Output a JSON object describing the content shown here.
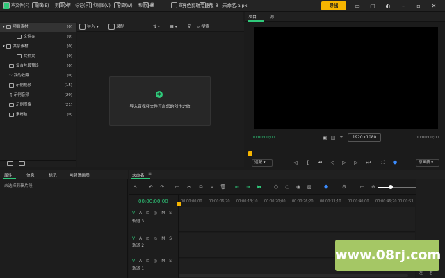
{
  "menu": [
    "文件(F)",
    "编辑(E)",
    "剪辑(X)",
    "标记(M)",
    "视图(V)",
    "窗口(W)",
    "帮助(H)"
  ],
  "title": "亮色剪辑专业版 8 - 未命名.alpx",
  "export_label": "导出",
  "toolbar": {
    "items": [
      "素",
      "文",
      "转",
      "行",
      "滤",
      "叠",
      "音",
      "贴"
    ]
  },
  "tree": {
    "items": [
      {
        "label": "项目素材",
        "count": "(0)"
      },
      {
        "label": "文件夹",
        "count": "(0)"
      },
      {
        "label": "共享素材",
        "count": "(0)"
      },
      {
        "label": "文件夹",
        "count": "(0)"
      },
      {
        "label": "复合片段预设",
        "count": "(0)"
      },
      {
        "label": "我的收藏",
        "count": "(0)"
      },
      {
        "label": "示例视频",
        "count": "(15)"
      },
      {
        "label": "示例音频",
        "count": "(29)"
      },
      {
        "label": "示例图像",
        "count": "(21)"
      },
      {
        "label": "素材包",
        "count": "(0)"
      }
    ]
  },
  "media": {
    "import_label": "导入",
    "record_label": "录制",
    "search_placeholder": "搜索",
    "empty_text": "导入音视频文件开启您的创作之旅"
  },
  "preview": {
    "tabs": [
      "项目",
      "源"
    ],
    "timecode_current": "00:00:00;00",
    "timecode_total": "00:00:00;00",
    "resolution": "1920×1080",
    "fit": "适配",
    "quality": "原画质"
  },
  "properties": {
    "tabs": [
      "属性",
      "信息",
      "标记",
      "AI超清画质"
    ],
    "empty_msg": "未选择剪辑片段"
  },
  "timeline": {
    "tab": "未命名",
    "timecode": "00:00:00;00",
    "ruler": [
      "00:00:00;00",
      "00:00:06;20",
      "00:00:13;10",
      "00:00:20;00",
      "00:00:26;20",
      "00:00:33;10",
      "00:00:40;00",
      "00:00:46;20",
      "00:00:53;10"
    ],
    "tracks": [
      "轨道 3",
      "轨道 2",
      "轨道 1"
    ],
    "track_controls": [
      "V",
      "A",
      "M",
      "S"
    ]
  },
  "meter": {
    "labels": [
      "左",
      "右"
    ]
  },
  "watermark": "www.08rj.com",
  "colors": {
    "accent": "#2fc97a",
    "export": "#f7b500",
    "highlight": "#3b8cff"
  }
}
